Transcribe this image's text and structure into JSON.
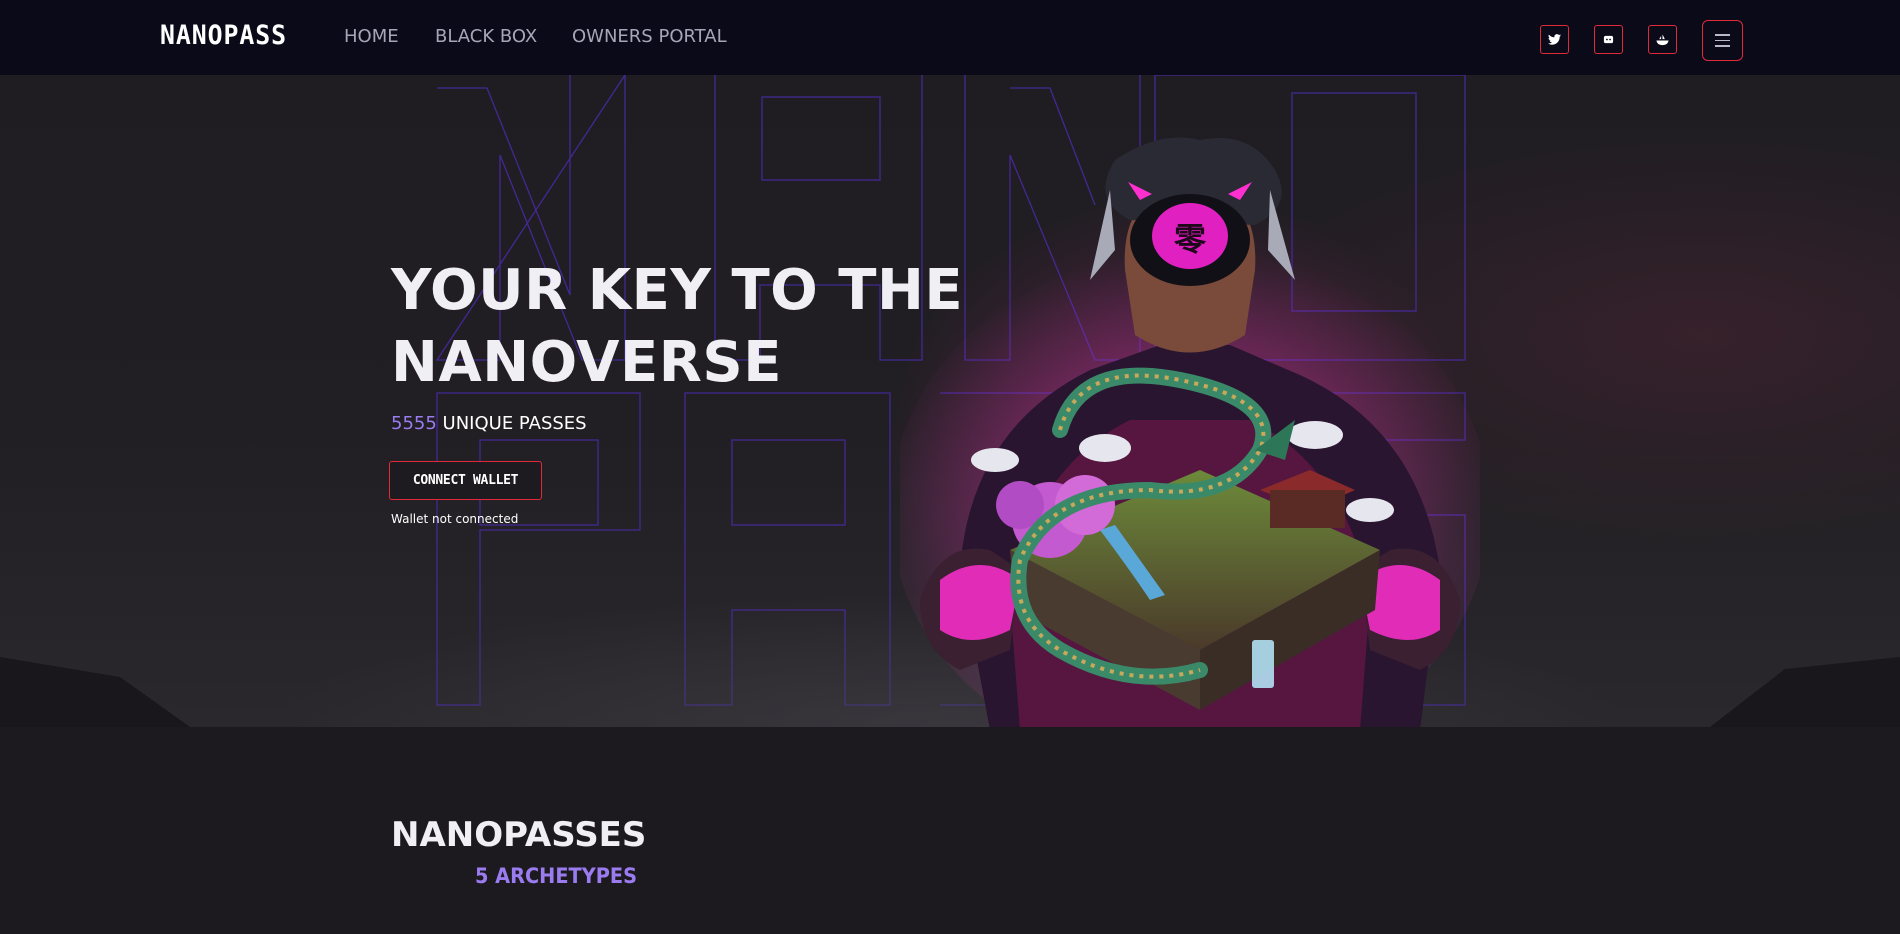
{
  "nav": {
    "logo": "NANOPASS",
    "links": [
      "HOME",
      "BLACK BOX",
      "OWNERS PORTAL"
    ],
    "social": [
      {
        "icon": "twitter-icon"
      },
      {
        "icon": "discord-icon"
      },
      {
        "icon": "opensea-icon"
      }
    ],
    "menu_icon": "hamburger-menu-icon"
  },
  "hero": {
    "headline_line1": "YOUR KEY TO THE",
    "headline_line2": "NANOVERSE",
    "pass_count": "5555",
    "pass_label": "UNIQUE PASSES",
    "connect_label": "CONNECT WALLET",
    "wallet_status": "Wallet not connected",
    "background_letters": "NANOPASS"
  },
  "section": {
    "title": "NANOPASSES",
    "subtitle": "5 ARCHETYPES"
  },
  "colors": {
    "nav_bg": "#0b0a19",
    "accent_red": "#e02a3a",
    "accent_purple": "#9a7cf0",
    "outline_purple": "#4a2aa8",
    "magenta_glow": "#e028c8",
    "page_bg": "#1c1a1f"
  }
}
